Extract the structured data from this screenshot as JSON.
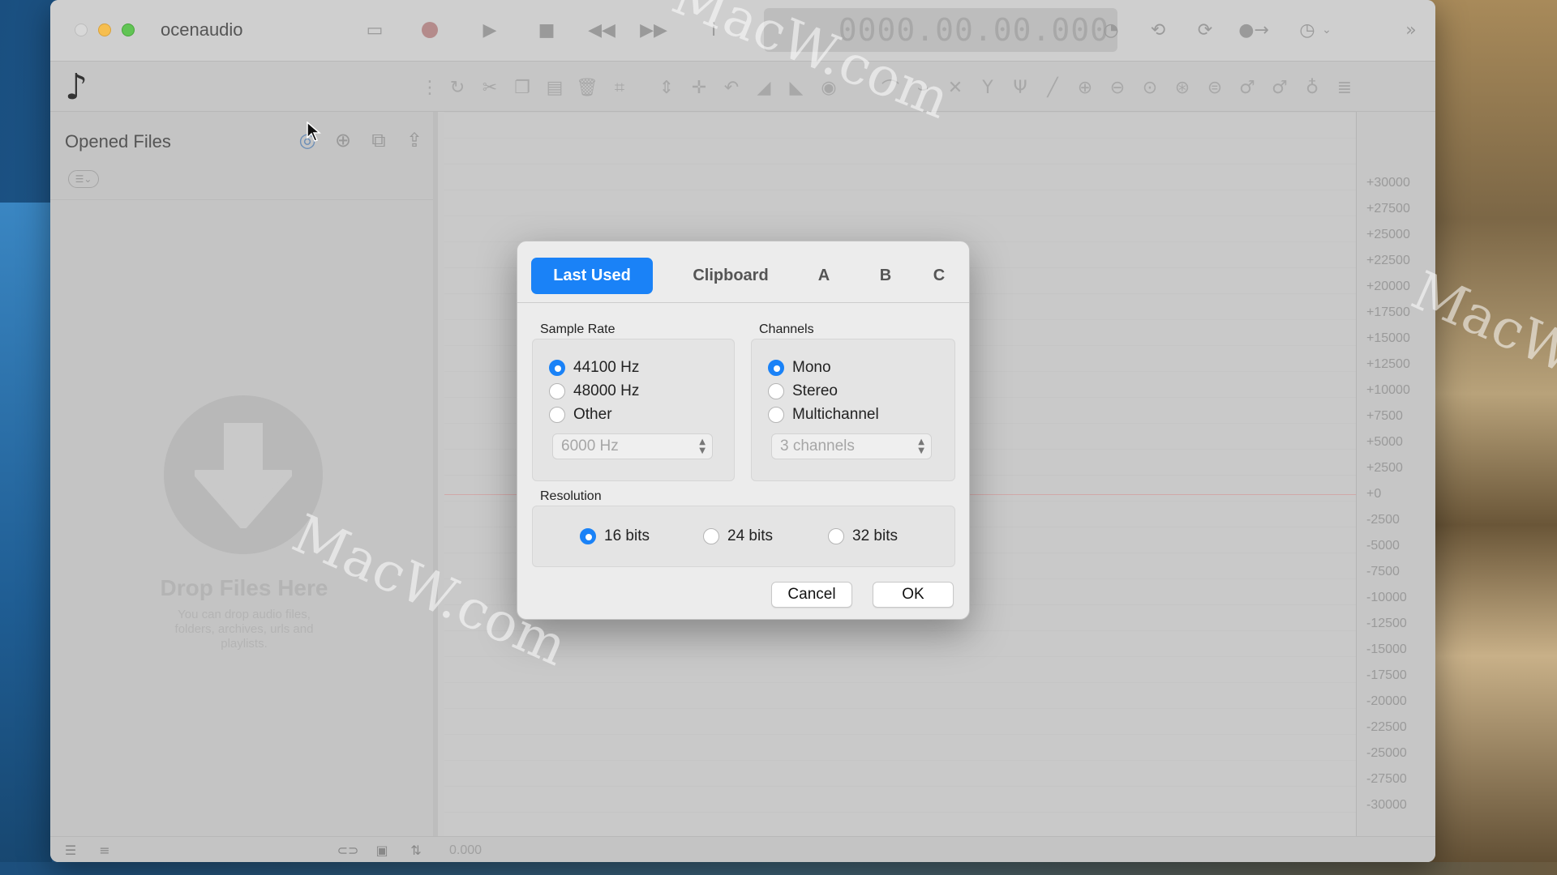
{
  "window": {
    "app_name": "ocenaudio",
    "time_display": "0000.00.00.000"
  },
  "sidebar": {
    "title": "Opened Files",
    "drop_title": "Drop Files Here",
    "drop_subtitle": "You can drop audio files, folders, archives, urls and playlists."
  },
  "dialog": {
    "tabs": [
      {
        "label": "Last Used",
        "active": true
      },
      {
        "label": "Clipboard",
        "active": false
      },
      {
        "label": "A",
        "active": false
      },
      {
        "label": "B",
        "active": false
      },
      {
        "label": "C",
        "active": false
      }
    ],
    "sample_rate": {
      "label": "Sample Rate",
      "options": [
        "44100 Hz",
        "48000 Hz",
        "Other"
      ],
      "selected": "44100 Hz",
      "other_value": "6000 Hz"
    },
    "channels": {
      "label": "Channels",
      "options": [
        "Mono",
        "Stereo",
        "Multichannel"
      ],
      "selected": "Mono",
      "multichannel_value": "3 channels"
    },
    "resolution": {
      "label": "Resolution",
      "options": [
        "16 bits",
        "24 bits",
        "32 bits"
      ],
      "selected": "16 bits"
    },
    "cancel_label": "Cancel",
    "ok_label": "OK",
    "accent_color": "#1a82f7"
  },
  "ruler": {
    "ticks": [
      "+30000",
      "+27500",
      "+25000",
      "+22500",
      "+20000",
      "+17500",
      "+15000",
      "+12500",
      "+10000",
      "+7500",
      "+5000",
      "+2500",
      "+0",
      "-2500",
      "-5000",
      "-7500",
      "-10000",
      "-12500",
      "-15000",
      "-17500",
      "-20000",
      "-22500",
      "-25000",
      "-27500",
      "-30000"
    ]
  },
  "status": {
    "time": "0.000"
  },
  "watermark": {
    "text": "MacW.com"
  }
}
